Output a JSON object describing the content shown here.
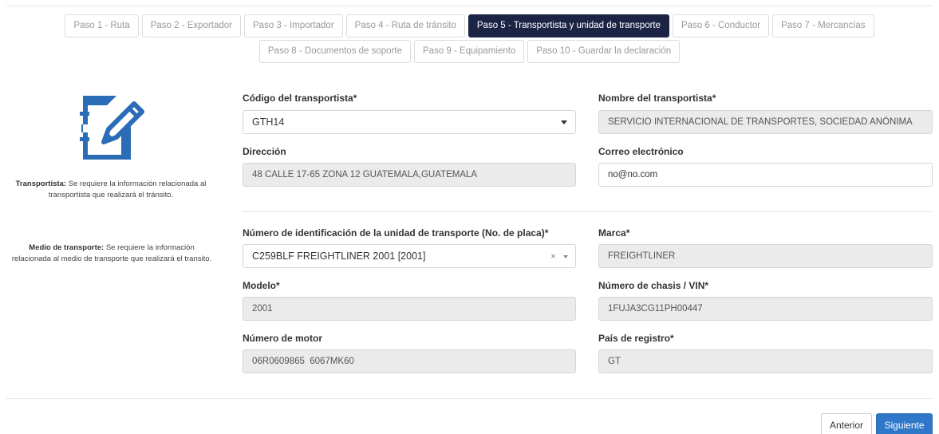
{
  "steps_row1": [
    {
      "label": "Paso 1 - Ruta",
      "active": false
    },
    {
      "label": "Paso 2 - Exportador",
      "active": false
    },
    {
      "label": "Paso 3 - Importador",
      "active": false
    },
    {
      "label": "Paso 4 - Ruta de tránsito",
      "active": false
    },
    {
      "label": "Paso 5 - Transportista y unidad de transporte",
      "active": true
    },
    {
      "label": "Paso 6 - Conductor",
      "active": false
    },
    {
      "label": "Paso 7 - Mercancías",
      "active": false
    }
  ],
  "steps_row2": [
    {
      "label": "Paso 8 - Documentos de soporte",
      "active": false
    },
    {
      "label": "Paso 9 - Equipamiento",
      "active": false
    },
    {
      "label": "Paso 10 - Guardar la declaración",
      "active": false
    }
  ],
  "side": {
    "transportista_title": "Transportista:",
    "transportista_text": " Se requiere la información relacionada al transportista que realizará el tránsito.",
    "medio_title": "Medio de transporte:",
    "medio_text": " Se requiere la información relacionada al medio de transporte que realizará el transito."
  },
  "carrier": {
    "code_label": "Código del transportista*",
    "code_value": "GTH14",
    "name_label": "Nombre del transportista*",
    "name_value": "SERVICIO INTERNACIONAL DE TRANSPORTES, SOCIEDAD ANÓNIMA",
    "address_label": "Dirección",
    "address_value": "48 CALLE 17-65 ZONA 12 GUATEMALA,GUATEMALA",
    "email_label": "Correo electrónico",
    "email_value": "no@no.com"
  },
  "vehicle": {
    "plate_label": "Número de identificación de la unidad de transporte (No. de placa)*",
    "plate_value": "C259BLF FREIGHTLINER 2001 [2001]",
    "clear_symbol": "×",
    "brand_label": "Marca*",
    "brand_value": "FREIGHTLINER",
    "model_label": "Modelo*",
    "model_value": "2001",
    "vin_label": "Número de chasis / VIN*",
    "vin_value": "1FUJA3CG11PH00447",
    "engine_label": "Número de motor",
    "engine_value": "06R0609865  6067MK60",
    "country_label": "País de registro*",
    "country_value": "GT"
  },
  "buttons": {
    "prev": "Anterior",
    "next": "Siguiente"
  },
  "colors": {
    "active_step": "#1c2445",
    "primary": "#2f77c8",
    "icon": "#2a6cb6"
  }
}
